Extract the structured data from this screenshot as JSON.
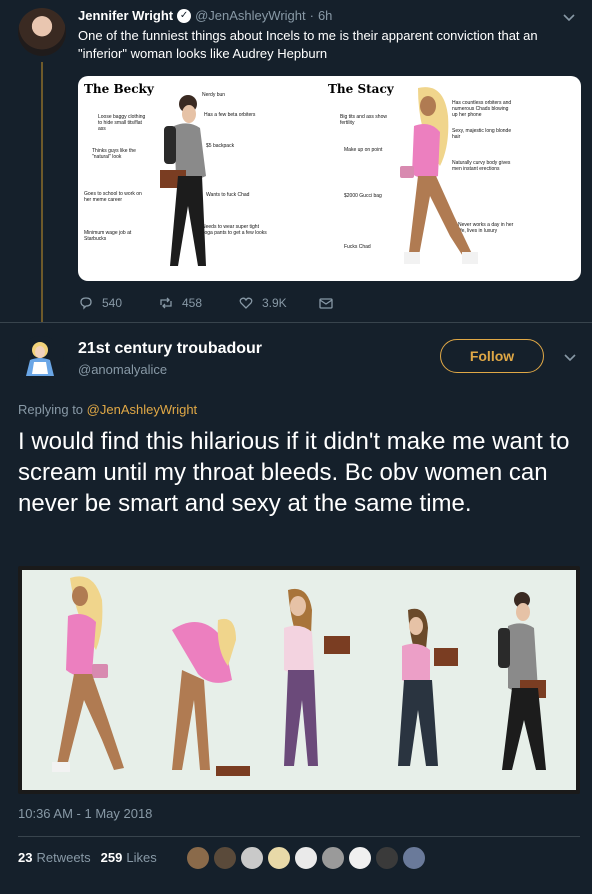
{
  "parent_tweet": {
    "name": "Jennifer Wright",
    "handle": "@JenAshleyWright",
    "time": "6h",
    "text": "One of the funniest things about Incels to me is their apparent conviction that an \"inferior\" woman looks like Audrey Hepburn",
    "meme": {
      "left_title": "The Becky",
      "right_title": "The Stacy",
      "left_notes": [
        "Nerdy bun",
        "Loose baggy clothing to hide small tits/flat ass",
        "Has a few beta orbiters",
        "$5 backpack",
        "Thinks guys like the \"natural\" look",
        "Goes to school to work on her meme career",
        "Wants to fuck Chad",
        "Minimum wage job at Starbucks",
        "Needs to wear super tight yoga pants to get a few looks"
      ],
      "right_notes": [
        "Has countless orbiters and numerous Chads blowing up her phone",
        "Big tits and ass show fertility",
        "Sexy, majestic long blonde hair",
        "Make up on point",
        "Naturally curvy body gives men instant erections",
        "$2000 Gucci bag",
        "Never works a day in her life, lives in luxury",
        "Fucks Chad"
      ]
    },
    "replies": "540",
    "retweets": "458",
    "likes": "3.9K"
  },
  "main_tweet": {
    "name": "21st century troubadour",
    "handle": "@anomalyalice",
    "follow_label": "Follow",
    "replying_prefix": "Replying to",
    "replying_to": "@JenAshleyWright",
    "text": "I would find this hilarious if it didn't make me want to scream until my throat bleeds. Bc obv women can never be smart and sexy at the same time.",
    "timestamp": "10:36 AM - 1 May 2018",
    "retweet_count": "23",
    "retweet_label": "Retweets",
    "like_count": "259",
    "like_label": "Likes"
  },
  "colors": {
    "background": "#15202b",
    "accent": "#e0a846",
    "muted": "#8899a6",
    "divider": "#38444d"
  }
}
